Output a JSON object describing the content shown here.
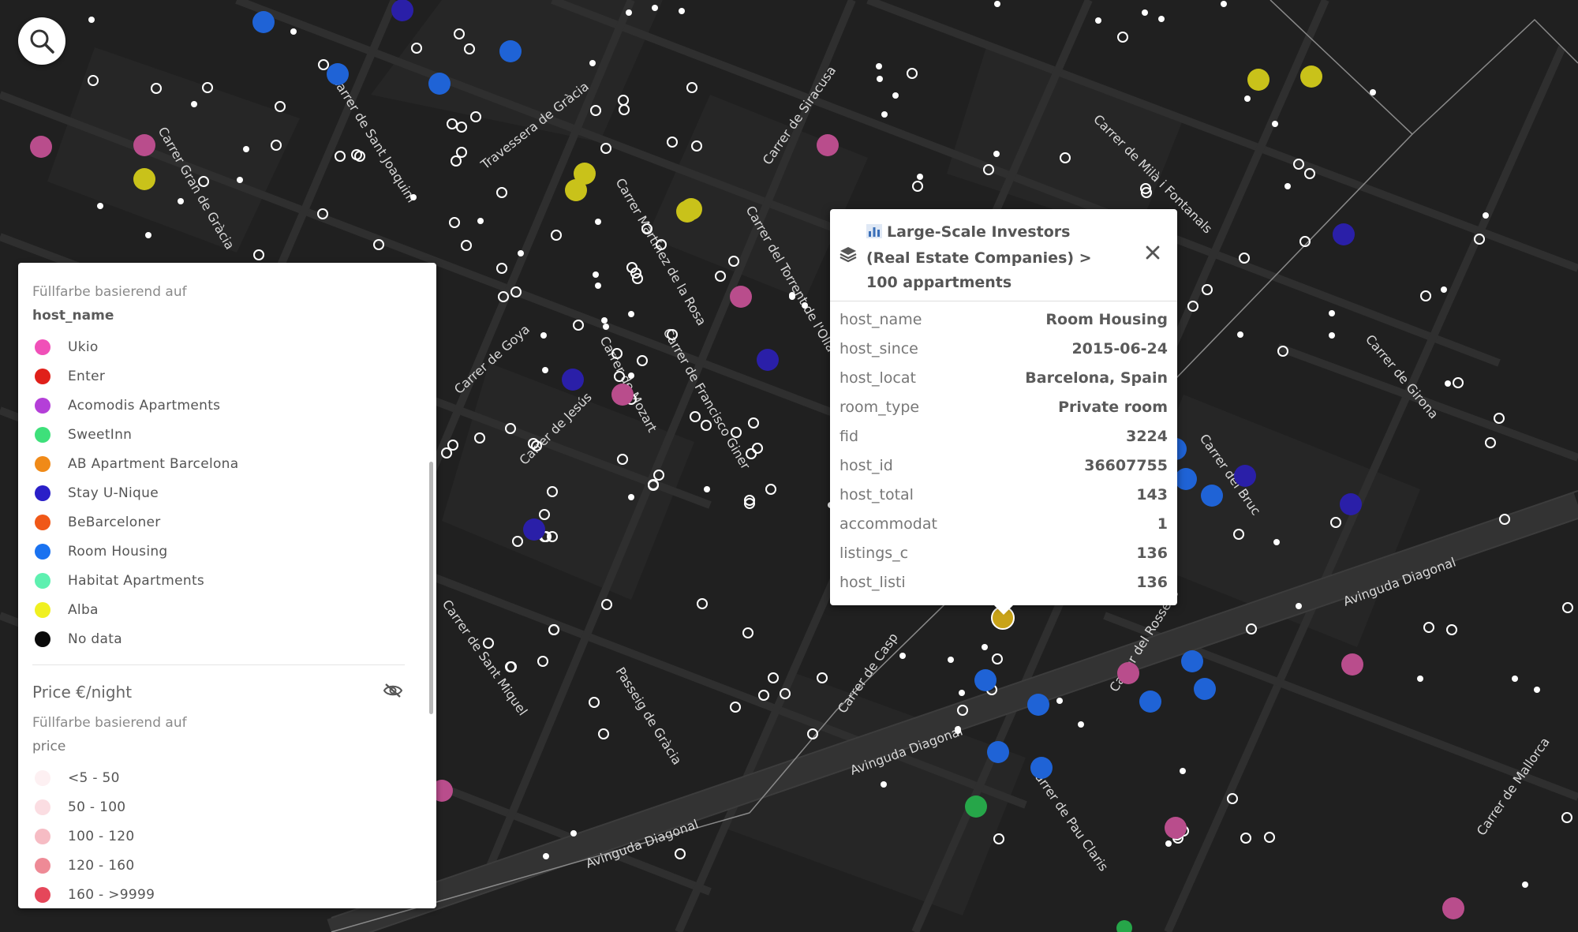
{
  "colors": {
    "map_bg": "#202020",
    "blue": "#1f63d6",
    "navy": "#2a1fa8",
    "pink": "#b94d8c",
    "yellow": "#c9c21a",
    "green": "#26a649",
    "popup_marker": "#c9a319"
  },
  "search": {
    "icon": "search-icon"
  },
  "streets": [
    "Carrer Gran de Gràcia",
    "Carrer de Sant Joaquim",
    "Travessera de Gràcia",
    "Carrer Martínez de la Rosa",
    "Carrer del Torrent de l'Olla",
    "Carrer de Siracusa",
    "Carrer de Milà i Fontanals",
    "Carrer del Rosselló",
    "Carrer de Girona",
    "Carrer del Bruc",
    "Carrer de Goya",
    "Carrer de Francisco Giner",
    "Carrer de Jesús",
    "Carrer de Mozart",
    "Carrer de Sant Miquel",
    "Passeig de Gràcia",
    "Avinguda Diagonal",
    "Carrer de Pau Claris",
    "Carrer de Mallorca",
    "Carrer de Casp"
  ],
  "legend": {
    "host_section": {
      "subtitle": "Füllfarbe basierend auf",
      "field": "host_name",
      "items": [
        {
          "label": "Ukio",
          "color": "#f050b8"
        },
        {
          "label": "Enter",
          "color": "#e0201a"
        },
        {
          "label": "Acomodis Apartments",
          "color": "#b43fd8"
        },
        {
          "label": "SweetInn",
          "color": "#3ee07a"
        },
        {
          "label": "AB Apartment Barcelona",
          "color": "#f08a18"
        },
        {
          "label": "Stay U-Nique",
          "color": "#2a1fc8"
        },
        {
          "label": "BeBarceloner",
          "color": "#f05818"
        },
        {
          "label": "Room Housing",
          "color": "#1a72f0"
        },
        {
          "label": "Habitat Apartments",
          "color": "#5ef0b0"
        },
        {
          "label": "Alba",
          "color": "#f0f020"
        },
        {
          "label": "No data",
          "color": "#0a0a0a"
        }
      ]
    },
    "price_section": {
      "title": "Price €/night",
      "visibility_icon": "eye-off-icon",
      "subtitle": "Füllfarbe basierend auf",
      "field": "price",
      "items": [
        {
          "label": "<5 - 50",
          "color": "#fdf0f2"
        },
        {
          "label": "50 - 100",
          "color": "#fbdde2"
        },
        {
          "label": "100 - 120",
          "color": "#f6bcc4"
        },
        {
          "label": "120 - 160",
          "color": "#ee8a96"
        },
        {
          "label": "160 - >9999",
          "color": "#e5475a"
        }
      ]
    }
  },
  "popup": {
    "title_icon": "bar-chart-icon",
    "layer_icon": "layers-icon",
    "title": "Large-Scale Investors (Real Estate Companies) > 100 appartments",
    "rows": [
      {
        "key": "host_name",
        "value": "Room Housing"
      },
      {
        "key": "host_since",
        "value": "2015-06-24"
      },
      {
        "key": "host_locat",
        "value": "Barcelona, Spain"
      },
      {
        "key": "room_type",
        "value": "Private room"
      },
      {
        "key": "fid",
        "value": "3224"
      },
      {
        "key": "host_id",
        "value": "36607755"
      },
      {
        "key": "host_total",
        "value": "143"
      },
      {
        "key": "accommodat",
        "value": "1"
      },
      {
        "key": "listings_c",
        "value": "136"
      },
      {
        "key": "host_listi",
        "value": "136"
      }
    ]
  }
}
